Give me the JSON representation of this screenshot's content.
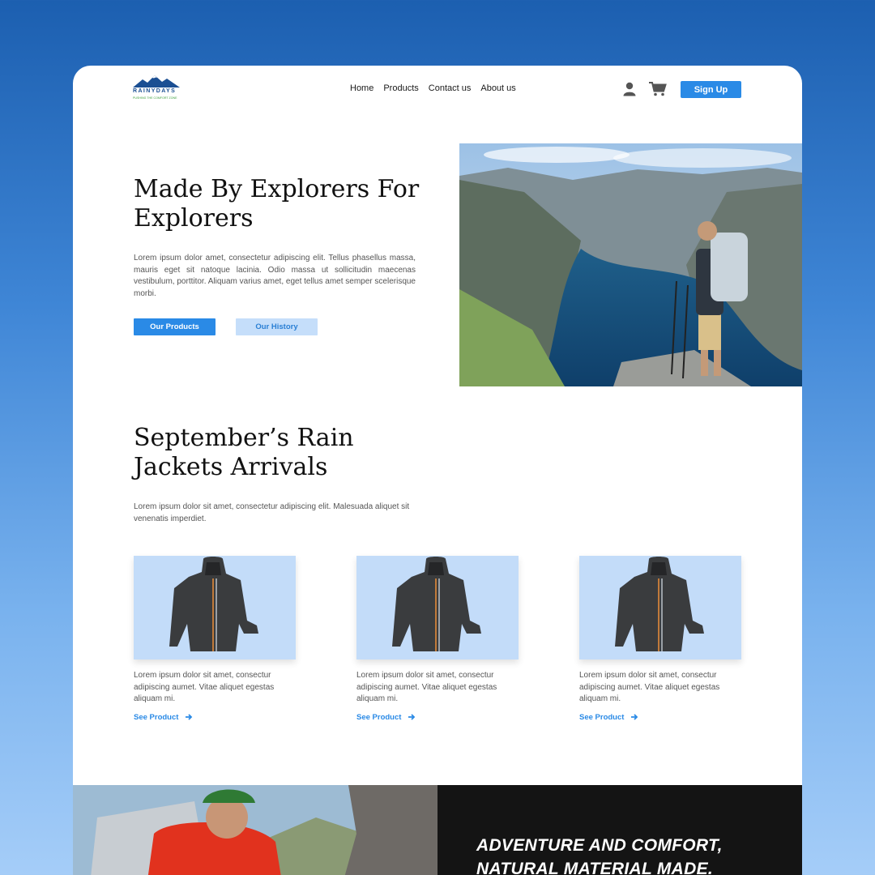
{
  "brand": {
    "name": "RAINYDAYS",
    "tagline": "PUSHING THE COMFORT ZONE"
  },
  "nav": {
    "items": [
      "Home",
      "Products",
      "Contact us",
      "About us"
    ]
  },
  "header": {
    "signup_label": "Sign Up",
    "icons": [
      "user-icon",
      "cart-icon"
    ]
  },
  "hero": {
    "title": "Made By Explorers For Explorers",
    "text": "Lorem ipsum dolor amet, consectetur adipiscing elit. Tellus phasellus massa, mauris eget sit natoque lacinia. Odio massa ut sollicitudin maecenas vestibulum, porttitor. Aliquam varius amet, eget tellus amet semper scelerisque morbi.",
    "primary_button": "Our Products",
    "secondary_button": "Our History"
  },
  "arrivals": {
    "title": "September’s Rain Jackets Arrivals",
    "text": "Lorem ipsum dolor sit amet, consectetur adipiscing elit. Malesuada aliquet sit venenatis imperdiet.",
    "products": [
      {
        "text": "Lorem ipsum dolor sit amet, consectur adipiscing aumet. Vitae aliquet egestas aliquam mi.",
        "link": "See Product"
      },
      {
        "text": "Lorem ipsum dolor sit amet, consectur adipiscing aumet. Vitae aliquet egestas aliquam mi.",
        "link": "See Product"
      },
      {
        "text": "Lorem ipsum dolor sit amet, consectur adipiscing aumet. Vitae aliquet egestas aliquam mi.",
        "link": "See Product"
      }
    ]
  },
  "banner": {
    "heading": "ADVENTURE AND COMFORT, NATURAL MATERIAL MADE."
  },
  "colors": {
    "accent": "#2a8ae6",
    "accent_light": "#c5defa",
    "card_bg": "#c3dcf9",
    "banner_dark": "#141414"
  }
}
